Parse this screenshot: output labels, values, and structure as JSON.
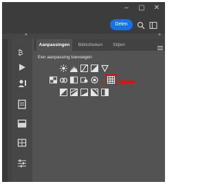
{
  "window": {
    "minimize": "–",
    "maximize": "▢",
    "close": "✕"
  },
  "share": {
    "label": "Delen"
  },
  "panel": {
    "collapse_left": "«",
    "collapse_right": "»",
    "tabs": [
      "Aanpassingen",
      "Bibliotheken",
      "Stijlen"
    ],
    "heading": "Een aanpassing toevoegen"
  },
  "icons": {
    "tools": [
      "history-brush-icon",
      "play-icon",
      "user-icon",
      "document-icon",
      "layers-icon",
      "grid-icon",
      "sliders-icon"
    ],
    "adjustments_row1": [
      "brightness-icon",
      "levels-icon",
      "curves-icon",
      "exposure-icon",
      "gradient-triangle-icon"
    ],
    "adjustments_row2": [
      "vibrance-icon",
      "hue-saturation-icon",
      "color-balance-icon",
      "black-white-icon",
      "photo-filter-icon",
      "channel-mixer-icon"
    ],
    "adjustments_row3": [
      "invert-icon",
      "posterize-icon",
      "threshold-icon",
      "gradient-map-icon",
      "selective-color-icon"
    ]
  },
  "colors": {
    "accent": "#1473e6",
    "highlight": "#e01010",
    "panel_bg": "#535353",
    "chrome_bg": "#3c3c3c"
  }
}
